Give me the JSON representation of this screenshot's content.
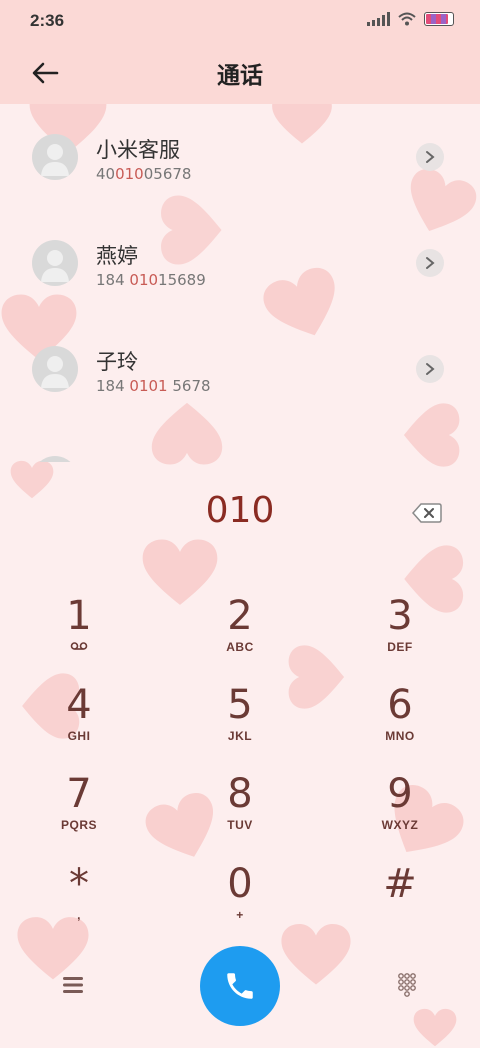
{
  "status_bar": {
    "time": "2:36"
  },
  "header": {
    "title": "通话"
  },
  "contacts": [
    {
      "name": "小米客服",
      "number_pre": "40",
      "number_match": "010",
      "number_post": "05678"
    },
    {
      "name": "燕婷",
      "number_pre": "184 ",
      "number_match": "010",
      "number_post": "15689"
    },
    {
      "name": "子玲",
      "number_pre": "184 ",
      "number_match": "0101",
      "number_post": " 5678"
    }
  ],
  "dialer": {
    "dialed_number": "010"
  },
  "keypad": [
    {
      "digit": "1",
      "letters": ""
    },
    {
      "digit": "2",
      "letters": "ABC"
    },
    {
      "digit": "3",
      "letters": "DEF"
    },
    {
      "digit": "4",
      "letters": "GHI"
    },
    {
      "digit": "5",
      "letters": "JKL"
    },
    {
      "digit": "6",
      "letters": "MNO"
    },
    {
      "digit": "7",
      "letters": "PQRS"
    },
    {
      "digit": "8",
      "letters": "TUV"
    },
    {
      "digit": "9",
      "letters": "WXYZ"
    },
    {
      "digit": "*",
      "letters": ","
    },
    {
      "digit": "0",
      "letters": "+"
    },
    {
      "digit": "#",
      "letters": ""
    }
  ],
  "colors": {
    "accent": "#1e9cf0",
    "highlight": "#c85b55",
    "header_bg": "#fbd9d6",
    "background": "#fdeeee"
  },
  "icons": {
    "back": "arrow-left-icon",
    "chevron": "chevron-right-icon",
    "backspace": "backspace-icon",
    "menu": "menu-icon",
    "call": "phone-icon",
    "keypad": "dialpad-icon",
    "voicemail": "voicemail-icon"
  }
}
